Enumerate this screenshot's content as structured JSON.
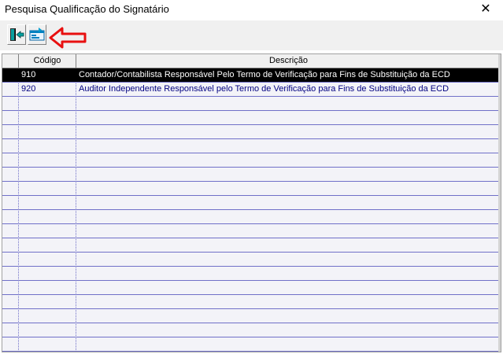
{
  "window": {
    "title": "Pesquisa Qualificação do Signatário",
    "close_glyph": "✕"
  },
  "toolbar": {
    "buttons": [
      {
        "name": "exit-button",
        "icon": "exit-door-icon"
      },
      {
        "name": "select-button",
        "icon": "select-record-icon"
      }
    ],
    "annotation_icon": "red-arrow-left-icon",
    "annotation_color": "#e81010"
  },
  "grid": {
    "columns": [
      {
        "key": "codigo",
        "label": "Código"
      },
      {
        "key": "descricao",
        "label": "Descrição"
      }
    ],
    "rows": [
      {
        "codigo": "910",
        "descricao": "Contador/Contabilista Responsável Pelo Termo de Verificação para Fins de Substituição da ECD",
        "selected": true
      },
      {
        "codigo": "920",
        "descricao": "Auditor Independente Responsável pelo Termo de Verificação para Fins de Substituição da ECD",
        "selected": false
      }
    ],
    "colors": {
      "selected_bg": "#000000",
      "text": "#000080",
      "grid_line": "#7070c8",
      "row_bg": "#f3f3f8"
    }
  }
}
